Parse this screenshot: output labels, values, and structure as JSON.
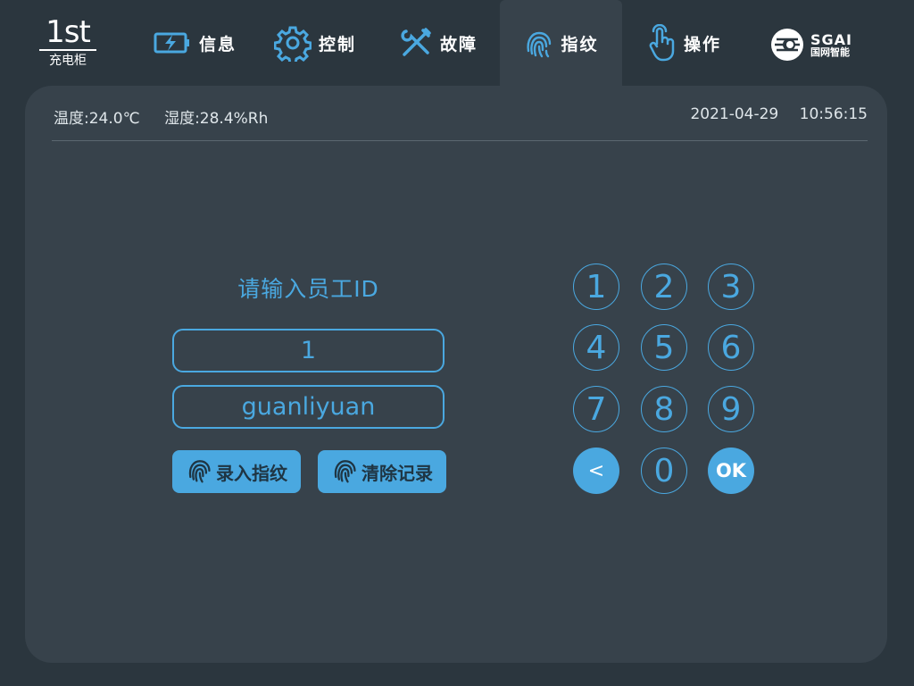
{
  "logo": {
    "title": "1st",
    "subtitle": "充电柜"
  },
  "nav": {
    "tabs": [
      {
        "label": "信息",
        "icon": "battery-charging-icon"
      },
      {
        "label": "控制",
        "icon": "gear-icon"
      },
      {
        "label": "故障",
        "icon": "wrench-screwdriver-icon"
      },
      {
        "label": "指纹",
        "icon": "fingerprint-icon",
        "active": true
      },
      {
        "label": "操作",
        "icon": "hand-pointer-icon"
      }
    ],
    "brand": {
      "en": "SGAI",
      "cn": "国网智能"
    }
  },
  "status": {
    "temperature": "温度:24.0℃",
    "humidity": "湿度:28.4%Rh",
    "date": "2021-04-29",
    "time": "10:56:15"
  },
  "form": {
    "title": "请输入员工ID",
    "employee_id": "1",
    "employee_name": "guanliyuan",
    "enroll_label": "录入指纹",
    "clear_label": "清除记录"
  },
  "keypad": {
    "keys": [
      "1",
      "2",
      "3",
      "4",
      "5",
      "6",
      "7",
      "8",
      "9",
      "<",
      "0",
      "OK"
    ]
  },
  "colors": {
    "accent": "#4aa8e0",
    "background": "#2b363e",
    "panel": "#37424b"
  }
}
